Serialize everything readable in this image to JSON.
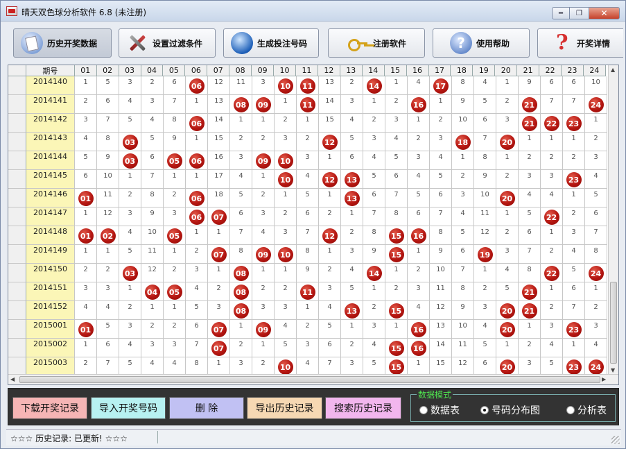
{
  "window": {
    "title": "晴天双色球分析软件 6.8  (未注册)",
    "min": "━",
    "max": "❐",
    "close": "✕"
  },
  "toolbar": {
    "history": "历史开奖数据",
    "filter": "设置过滤条件",
    "generate": "生成投注号码",
    "register": "注册软件",
    "help": "使用帮助",
    "details": "开奖详情"
  },
  "grid": {
    "header_period": "期号",
    "headers": [
      "01",
      "02",
      "03",
      "04",
      "05",
      "06",
      "07",
      "08",
      "09",
      "10",
      "11",
      "12",
      "13",
      "14",
      "15",
      "16",
      "17",
      "18",
      "19",
      "20",
      "21",
      "22",
      "23",
      "24"
    ],
    "rows": [
      {
        "period": "2014140",
        "cells": [
          "1",
          "5",
          "3",
          "2",
          "6",
          "06",
          "12",
          "11",
          "3",
          "10",
          "11",
          "13",
          "2",
          "14",
          "1",
          "4",
          "17",
          "8",
          "4",
          "1",
          "9",
          "6",
          "6",
          "10"
        ],
        "hits": [
          6,
          10,
          11,
          14,
          17
        ]
      },
      {
        "period": "2014141",
        "cells": [
          "2",
          "6",
          "4",
          "3",
          "7",
          "1",
          "13",
          "08",
          "09",
          "1",
          "11",
          "14",
          "3",
          "1",
          "2",
          "16",
          "1",
          "9",
          "5",
          "2",
          "21",
          "7",
          "7",
          "24"
        ],
        "hits": [
          8,
          9,
          11,
          16,
          21,
          24
        ]
      },
      {
        "period": "2014142",
        "cells": [
          "3",
          "7",
          "5",
          "4",
          "8",
          "06",
          "14",
          "1",
          "1",
          "2",
          "1",
          "15",
          "4",
          "2",
          "3",
          "1",
          "2",
          "10",
          "6",
          "3",
          "21",
          "22",
          "23",
          "1"
        ],
        "hits": [
          6,
          21,
          22,
          23
        ]
      },
      {
        "period": "2014143",
        "cells": [
          "4",
          "8",
          "03",
          "5",
          "9",
          "1",
          "15",
          "2",
          "2",
          "3",
          "2",
          "12",
          "5",
          "3",
          "4",
          "2",
          "3",
          "18",
          "7",
          "20",
          "1",
          "1",
          "1",
          "2"
        ],
        "hits": [
          3,
          12,
          18,
          20
        ]
      },
      {
        "period": "2014144",
        "cells": [
          "5",
          "9",
          "03",
          "6",
          "05",
          "06",
          "16",
          "3",
          "09",
          "10",
          "3",
          "1",
          "6",
          "4",
          "5",
          "3",
          "4",
          "1",
          "8",
          "1",
          "2",
          "2",
          "2",
          "3"
        ],
        "hits": [
          3,
          5,
          6,
          9,
          10
        ]
      },
      {
        "period": "2014145",
        "cells": [
          "6",
          "10",
          "1",
          "7",
          "1",
          "1",
          "17",
          "4",
          "1",
          "10",
          "4",
          "12",
          "13",
          "5",
          "6",
          "4",
          "5",
          "2",
          "9",
          "2",
          "3",
          "3",
          "23",
          "4"
        ],
        "hits": [
          10,
          12,
          13,
          23
        ]
      },
      {
        "period": "2014146",
        "cells": [
          "01",
          "11",
          "2",
          "8",
          "2",
          "06",
          "18",
          "5",
          "2",
          "1",
          "5",
          "1",
          "13",
          "6",
          "7",
          "5",
          "6",
          "3",
          "10",
          "20",
          "4",
          "4",
          "1",
          "5"
        ],
        "hits": [
          1,
          6,
          13,
          20
        ]
      },
      {
        "period": "2014147",
        "cells": [
          "1",
          "12",
          "3",
          "9",
          "3",
          "06",
          "07",
          "6",
          "3",
          "2",
          "6",
          "2",
          "1",
          "7",
          "8",
          "6",
          "7",
          "4",
          "11",
          "1",
          "5",
          "22",
          "2",
          "6"
        ],
        "hits": [
          6,
          7,
          22
        ]
      },
      {
        "period": "2014148",
        "cells": [
          "01",
          "02",
          "4",
          "10",
          "05",
          "1",
          "1",
          "7",
          "4",
          "3",
          "7",
          "12",
          "2",
          "8",
          "15",
          "16",
          "8",
          "5",
          "12",
          "2",
          "6",
          "1",
          "3",
          "7"
        ],
        "hits": [
          1,
          2,
          5,
          12,
          15,
          16
        ]
      },
      {
        "period": "2014149",
        "cells": [
          "1",
          "1",
          "5",
          "11",
          "1",
          "2",
          "07",
          "8",
          "09",
          "10",
          "8",
          "1",
          "3",
          "9",
          "15",
          "1",
          "9",
          "6",
          "19",
          "3",
          "7",
          "2",
          "4",
          "8"
        ],
        "hits": [
          7,
          9,
          10,
          15,
          19
        ]
      },
      {
        "period": "2014150",
        "cells": [
          "2",
          "2",
          "03",
          "12",
          "2",
          "3",
          "1",
          "08",
          "1",
          "1",
          "9",
          "2",
          "4",
          "14",
          "1",
          "2",
          "10",
          "7",
          "1",
          "4",
          "8",
          "22",
          "5",
          "24"
        ],
        "hits": [
          3,
          8,
          14,
          22,
          24
        ]
      },
      {
        "period": "2014151",
        "cells": [
          "3",
          "3",
          "1",
          "04",
          "05",
          "4",
          "2",
          "08",
          "2",
          "2",
          "11",
          "3",
          "5",
          "1",
          "2",
          "3",
          "11",
          "8",
          "2",
          "5",
          "21",
          "1",
          "6",
          "1"
        ],
        "hits": [
          4,
          5,
          8,
          11,
          21
        ]
      },
      {
        "period": "2014152",
        "cells": [
          "4",
          "4",
          "2",
          "1",
          "1",
          "5",
          "3",
          "08",
          "3",
          "3",
          "1",
          "4",
          "13",
          "2",
          "15",
          "4",
          "12",
          "9",
          "3",
          "20",
          "21",
          "2",
          "7",
          "2"
        ],
        "hits": [
          8,
          13,
          15,
          20,
          21
        ]
      },
      {
        "period": "2015001",
        "cells": [
          "01",
          "5",
          "3",
          "2",
          "2",
          "6",
          "07",
          "1",
          "09",
          "4",
          "2",
          "5",
          "1",
          "3",
          "1",
          "16",
          "13",
          "10",
          "4",
          "20",
          "1",
          "3",
          "23",
          "3"
        ],
        "hits": [
          1,
          7,
          9,
          16,
          20,
          23
        ]
      },
      {
        "period": "2015002",
        "cells": [
          "1",
          "6",
          "4",
          "3",
          "3",
          "7",
          "07",
          "2",
          "1",
          "5",
          "3",
          "6",
          "2",
          "4",
          "15",
          "16",
          "14",
          "11",
          "5",
          "1",
          "2",
          "4",
          "1",
          "4"
        ],
        "hits": [
          7,
          15,
          16
        ]
      },
      {
        "period": "2015003",
        "cells": [
          "2",
          "7",
          "5",
          "4",
          "4",
          "8",
          "1",
          "3",
          "2",
          "10",
          "4",
          "7",
          "3",
          "5",
          "15",
          "1",
          "15",
          "12",
          "6",
          "20",
          "3",
          "5",
          "23",
          "24"
        ],
        "hits": [
          10,
          15,
          20,
          23,
          24
        ]
      }
    ],
    "scroll_up": "▲",
    "scroll_down": "▼",
    "scroll_left": "◀",
    "scroll_right": "▶"
  },
  "actions": {
    "download": "下载开奖记录",
    "import": "导入开奖号码",
    "delete": "删 除",
    "export": "导出历史记录",
    "search": "搜索历史记录"
  },
  "mode": {
    "title": "数据模式",
    "options": [
      "数据表",
      "号码分布图",
      "分析表"
    ],
    "selected": "号码分布图"
  },
  "status": {
    "text": "☆☆☆  历史记录:  已更新!  ☆☆☆"
  },
  "colors": {
    "ball": "#b51611",
    "period_bg": "#fbf6b7",
    "download_bg": "#f6b5b5",
    "import_bg": "#b7f1f1",
    "delete_bg": "#c1c1f3",
    "export_bg": "#f6d8b3",
    "search_bg": "#f2b6ee"
  }
}
